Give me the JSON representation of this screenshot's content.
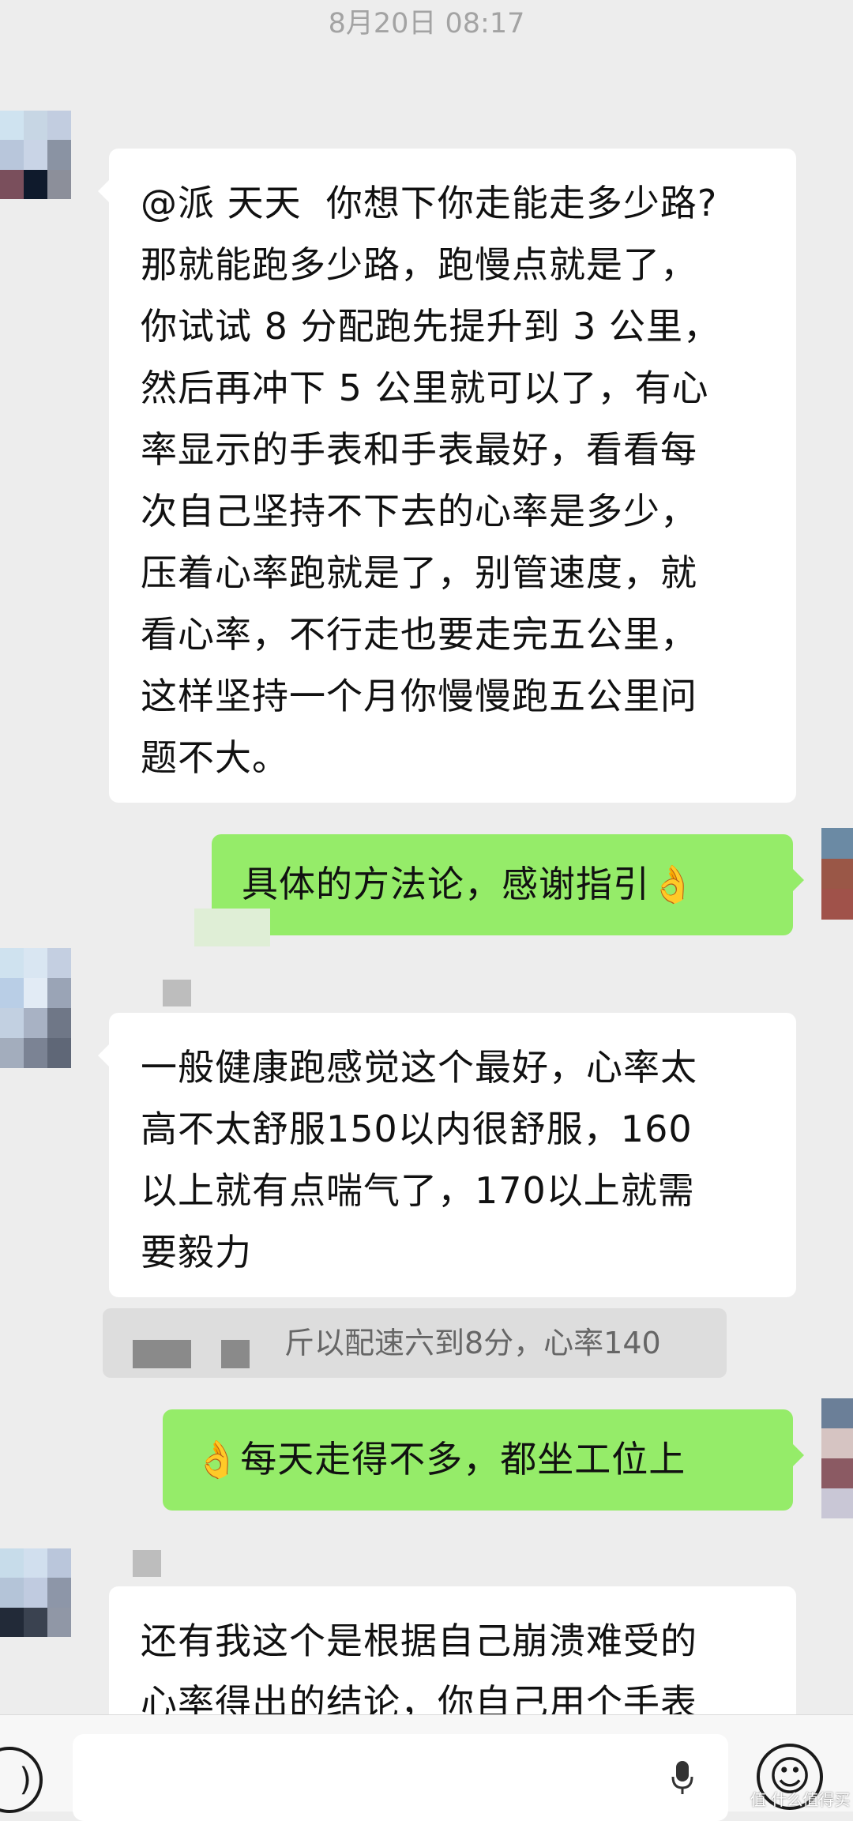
{
  "chat": {
    "timestamp": "8月20日 08:17",
    "messages": [
      {
        "direction": "incoming",
        "text": "@派 天天  你想下你走能走多少路?\n那就能跑多少路，跑慢点就是了，\n你试试 8 分配跑先提升到 3 公里，\n然后再冲下 5 公里就可以了，有心\n率显示的手表和手表最好，看看每\n次自己坚持不下去的心率是多少，\n压着心率跑就是了，别管速度，就\n看心率，不行走也要走完五公里，\n这样坚持一个月你慢慢跑五公里问\n题不大。"
      },
      {
        "direction": "outgoing",
        "text": "具体的方法论，感谢指引👌"
      },
      {
        "direction": "incoming",
        "text": "一般健康跑感觉这个最好，心率太\n高不太舒服150以内很舒服，160\n以上就有点喘气了，170以上就需\n要毅力"
      },
      {
        "direction": "quote",
        "text": "斤以配速六到8分，心率140"
      },
      {
        "direction": "outgoing",
        "text": "👌每天走得不多，都坐工位上"
      },
      {
        "direction": "incoming",
        "text": "还有我这个是根据自己崩溃难受的\n心率得出的结论，你自己用个手表"
      }
    ]
  },
  "input_bar": {
    "voice_icon": "voice-icon",
    "mic_icon": "mic-icon",
    "emoji_icon": "emoji-icon"
  },
  "watermark": "值 什么值得买",
  "colors": {
    "background": "#ededed",
    "incoming_bubble": "#ffffff",
    "outgoing_bubble": "#95ec69"
  }
}
